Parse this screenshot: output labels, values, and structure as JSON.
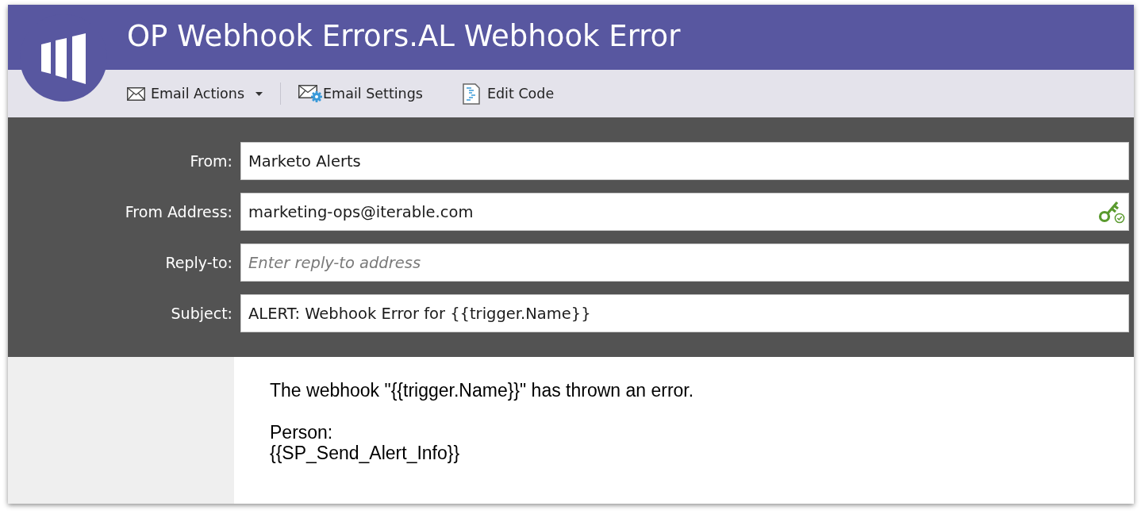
{
  "header": {
    "title": "OP Webhook Errors.AL Webhook Error"
  },
  "toolbar": [
    {
      "kind": "menu",
      "label": "Email Actions"
    },
    {
      "kind": "settings",
      "label": "Email Settings"
    },
    {
      "kind": "code",
      "label": "Edit Code"
    }
  ],
  "fields": [
    {
      "label": "From:",
      "value": "Marketo Alerts",
      "verified": false
    },
    {
      "label": "From Address:",
      "value": "marketing-ops@iterable.com",
      "verified": true
    },
    {
      "label": "Reply-to:",
      "placeholder": "Enter reply-to address",
      "verified": false
    },
    {
      "label": "Subject:",
      "value": "ALERT: Webhook Error for {{trigger.Name}}",
      "verified": false
    }
  ],
  "body": {
    "paragraphs": [
      {
        "lines": [
          "The webhook \"{{trigger.Name}}\" has thrown an error."
        ]
      },
      {
        "lines": [
          "Person:",
          "{{SP_Send_Alert_Info}}"
        ]
      }
    ]
  }
}
